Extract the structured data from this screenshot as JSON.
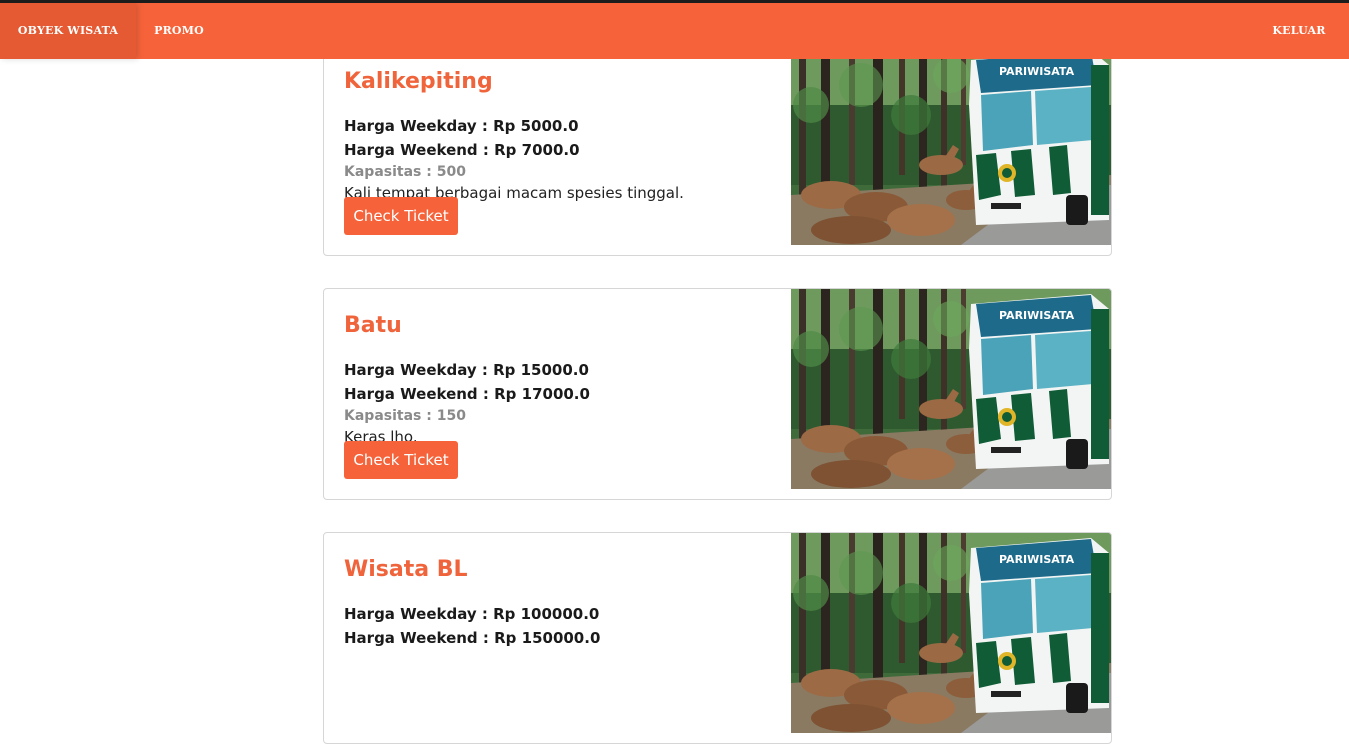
{
  "nav": {
    "items": [
      {
        "label": "OBYEK WISATA"
      },
      {
        "label": "PROMO"
      }
    ],
    "logout_label": "KELUAR"
  },
  "labels": {
    "weekday": "Harga Weekday : Rp ",
    "weekend": "Harga Weekend : Rp ",
    "kapasitas": "Kapasitas : ",
    "button": "Check Ticket"
  },
  "cards": [
    {
      "title": "Kalikepiting",
      "weekday": "Harga Weekday : Rp 5000.0",
      "weekend": "Harga Weekend : Rp 7000.0",
      "kapasitas": "Kapasitas : 500",
      "description": "Kali tempat berbagai macam spesies tinggal.",
      "button": "Check Ticket",
      "image_label": "PARIWISATA"
    },
    {
      "title": "Batu",
      "weekday": "Harga Weekday : Rp 15000.0",
      "weekend": "Harga Weekend : Rp 17000.0",
      "kapasitas": "Kapasitas : 150",
      "description": "Keras lho.",
      "button": "Check Ticket",
      "image_label": "PARIWISATA"
    },
    {
      "title": "Wisata BL",
      "weekday": "Harga Weekday : Rp 100000.0",
      "weekend": "Harga Weekend : Rp 150000.0",
      "kapasitas": "",
      "description": "",
      "button": "",
      "image_label": "PARIWISATA"
    }
  ],
  "colors": {
    "brand": "#f6633a",
    "title": "#f0643c",
    "muted": "#8a8a8a"
  }
}
